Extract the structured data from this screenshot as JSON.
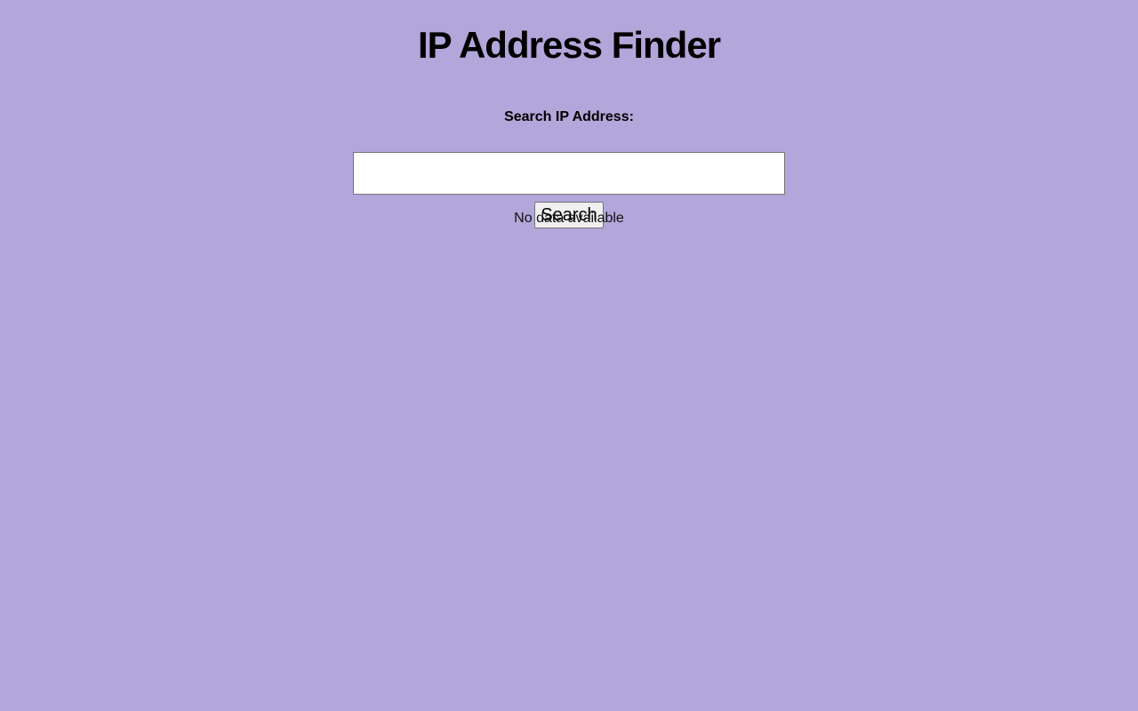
{
  "header": {
    "title": "IP Address Finder"
  },
  "search": {
    "label": "Search IP Address:",
    "value": "",
    "placeholder": "",
    "button_label": "Search"
  },
  "result": {
    "status_text": "No data available"
  },
  "colors": {
    "background": "#b2a6da",
    "input_background": "#ffffff",
    "button_background": "#efefef"
  }
}
